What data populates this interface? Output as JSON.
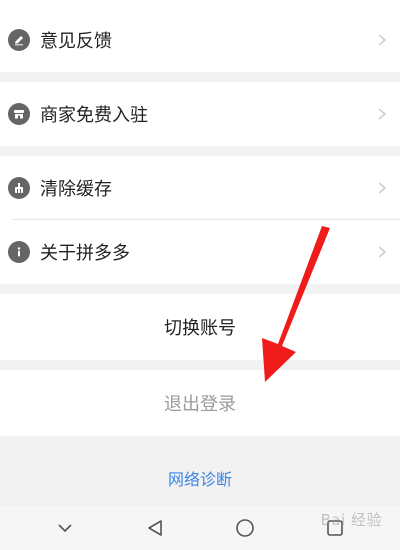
{
  "menu": {
    "group1": [
      {
        "label": "意见反馈",
        "icon": "pencil-icon"
      }
    ],
    "group2": [
      {
        "label": "商家免费入驻",
        "icon": "store-icon"
      }
    ],
    "group3": [
      {
        "label": "清除缓存",
        "icon": "broom-icon"
      },
      {
        "label": "关于拼多多",
        "icon": "info-icon"
      }
    ]
  },
  "actions": {
    "switch_account": "切换账号",
    "logout": "退出登录",
    "network_diagnosis": "网络诊断"
  },
  "navbar": {
    "items": [
      "back-icon",
      "triangle-back-icon",
      "home-circle-icon",
      "recents-square-icon"
    ]
  },
  "watermark": {
    "text": "Bai 经验"
  },
  "colors": {
    "accent": "#3a86e4",
    "annotation_arrow": "#f01c1c"
  }
}
